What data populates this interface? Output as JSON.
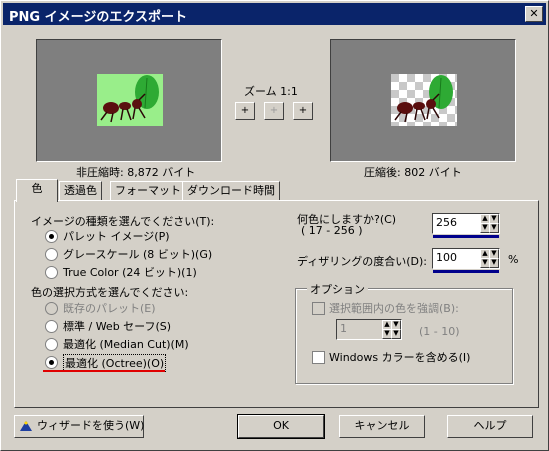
{
  "window": {
    "title": "PNG イメージのエクスポート",
    "close_glyph": "✕"
  },
  "preview": {
    "zoom_label": "ズーム 1:1",
    "before_label": "非圧縮時: 8,872 バイト",
    "after_label": "圧縮後: 802 バイト",
    "zoom_in": "+",
    "zoom_reset": "+",
    "zoom_out": "+"
  },
  "tabs": [
    "色",
    "透過色",
    "フォーマット",
    "ダウンロード時間"
  ],
  "image_type": {
    "heading": "イメージの種類を選んでください(T):",
    "options": [
      "パレット イメージ(P)",
      "グレースケール (8 ビット)(G)",
      "True Color (24 ビット)(1)"
    ],
    "selected": 0
  },
  "color_method": {
    "heading": "色の選択方式を選んでください:",
    "options": [
      "既存のパレット(E)",
      "標準 / Web セーフ(S)",
      "最適化 (Median Cut)(M)",
      "最適化 (Octree)(O)"
    ],
    "selected": 3
  },
  "colors": {
    "label": "何色にしますか?(C)",
    "range": "( 17 - 256 )",
    "value": "256"
  },
  "dither": {
    "label": "ディザリングの度合い(D):",
    "value": "100",
    "unit": "%"
  },
  "options": {
    "title": "オプション",
    "emphasize_label": "選択範囲内の色を強調(B):",
    "emphasize_value": "1",
    "emphasize_range": "(1 - 10)",
    "windows_colors_label": "Windows カラーを含める(I)"
  },
  "buttons": {
    "wizard": "ウィザードを使う(W)",
    "ok": "OK",
    "cancel": "キャンセル",
    "help": "ヘルプ"
  },
  "colors_accent": {
    "titlebar": "#0a246a",
    "preview_bg": "#7f7f7f",
    "leaf": "#2eaa34",
    "ant": "#5a0f0f"
  }
}
